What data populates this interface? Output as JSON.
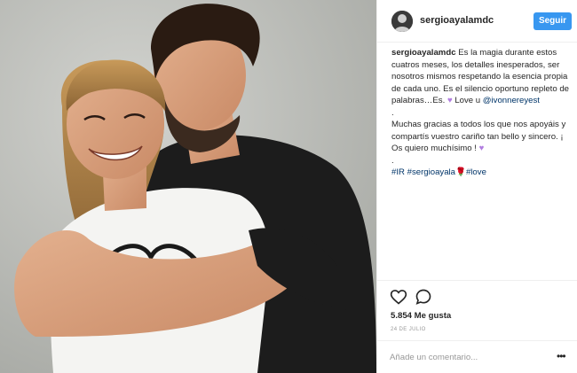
{
  "post": {
    "username": "sergioayalamdc",
    "follow_label": "Seguir",
    "caption": {
      "user": "sergioayalamdc",
      "paragraph1": "Es la magia durante estos cuatros meses, los detalles inesperados, ser nosotros mismos respetando la esencia propia de cada uno. Es el silencio oportuno repleto de palabras…Es.",
      "love_text": "Love u",
      "mention": "@ivonnereyest",
      "dot1": ".",
      "paragraph2": "Muchas gracias a todos los que nos apoyáis y compartís vuestro cariño tan bello y sincero. ¡ Os quiero muchísimo !",
      "dot2": ".",
      "hashtags": [
        "#IR",
        "#sergioayala",
        "#love"
      ],
      "heart_emoji": "♥",
      "rose_emoji": "🌹"
    },
    "likes": "5.854 Me gusta",
    "date": "24 DE JULIO",
    "comment_placeholder": "Añade un comentario...",
    "more_options": "•••"
  },
  "colors": {
    "follow_button": "#3897f0",
    "link": "#003569",
    "border": "#efefef"
  },
  "icons": {
    "like": "heart-outline-icon",
    "comment": "speech-bubble-icon",
    "more": "ellipsis-icon"
  }
}
